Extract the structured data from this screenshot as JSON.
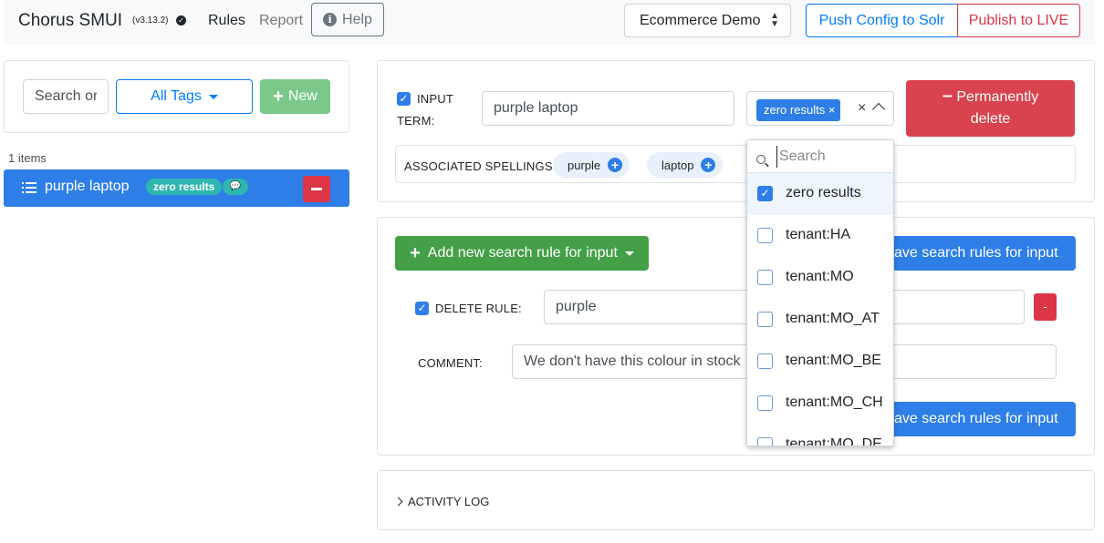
{
  "header": {
    "brand": "Chorus SMUI",
    "version": "(v3.13.2)",
    "nav": {
      "rules": "Rules",
      "report": "Report",
      "help": "Help"
    },
    "solr_index": "Ecommerce Demo",
    "push_config": "Push Config to Solr",
    "publish_live": "Publish to LIVE"
  },
  "sidebar": {
    "search_placeholder": "Search or",
    "tags_button": "All Tags",
    "new_button": "New",
    "items_count": "1 items",
    "items": [
      {
        "label": "purple laptop",
        "tag": "zero results"
      }
    ]
  },
  "input_card": {
    "input_label_line1": "INPUT",
    "input_label_line2": "TERM:",
    "input_value": "purple laptop",
    "selected_tag": "zero results",
    "permanently_delete_line1": "Permanently",
    "permanently_delete_line2": "delete",
    "spellings_label": "ASSOCIATED SPELLINGS:",
    "spellings": [
      "purple",
      "laptop"
    ]
  },
  "rules_card": {
    "add_rule": "Add new search rule for input",
    "save_rules": "Save search rules for input",
    "save_rules_visible": "ave search rules for input",
    "delete_rule_label": "DELETE RULE:",
    "delete_rule_value": "purple",
    "comment_label": "COMMENT:",
    "comment_value": "We don't have this colour in stock",
    "remove_rule": "-"
  },
  "activity_log": {
    "label": "ACTIVITY LOG"
  },
  "tag_dropdown": {
    "search_placeholder": "Search",
    "options": [
      {
        "label": "zero results",
        "checked": true
      },
      {
        "label": "tenant:HA",
        "checked": false
      },
      {
        "label": "tenant:MO",
        "checked": false
      },
      {
        "label": "tenant:MO_AT",
        "checked": false
      },
      {
        "label": "tenant:MO_BE",
        "checked": false
      },
      {
        "label": "tenant:MO_CH",
        "checked": false
      },
      {
        "label": "tenant:MO_DE",
        "checked": false
      }
    ]
  },
  "colors": {
    "primary": "#2e7ee8",
    "danger": "#dc3545",
    "success": "#43a047",
    "badge": "#2eb7b0"
  }
}
